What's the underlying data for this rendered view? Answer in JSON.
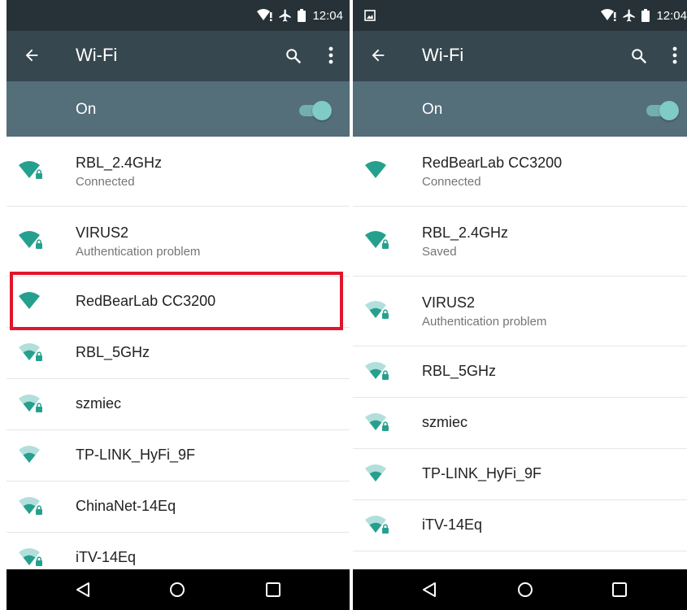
{
  "status_bar": {
    "time": "12:04",
    "icons": [
      "wifi-alert-icon",
      "airplane-icon",
      "battery-icon"
    ],
    "notification_icon": "image-icon"
  },
  "app_bar": {
    "title": "Wi-Fi",
    "back_icon": "arrow-left-icon",
    "search_icon": "search-icon",
    "more_icon": "more-vert-icon"
  },
  "wifi_switch": {
    "label": "On",
    "state": true
  },
  "nav_bar": {
    "icons": [
      "back-triangle-icon",
      "home-circle-icon",
      "recents-square-icon"
    ]
  },
  "colors": {
    "status_bar": "#263238",
    "app_bar": "#37474f",
    "switch_bar": "#546e7a",
    "accent": "#26a08e",
    "weak_signal": "#b2dfdb",
    "highlight": "#e1162b"
  },
  "left_screen": {
    "networks": [
      {
        "ssid": "RBL_2.4GHz",
        "status": "Connected",
        "signal": 4,
        "secured": true
      },
      {
        "ssid": "VIRUS2",
        "status": "Authentication problem",
        "signal": 4,
        "secured": true
      },
      {
        "ssid": "RedBearLab CC3200",
        "status": "",
        "signal": 4,
        "secured": false,
        "highlighted": true
      },
      {
        "ssid": "RBL_5GHz",
        "status": "",
        "signal": 2,
        "secured": true
      },
      {
        "ssid": "szmiec",
        "status": "",
        "signal": 2,
        "secured": true
      },
      {
        "ssid": "TP-LINK_HyFi_9F",
        "status": "",
        "signal": 2,
        "secured": false
      },
      {
        "ssid": "ChinaNet-14Eq",
        "status": "",
        "signal": 2,
        "secured": true
      },
      {
        "ssid": "iTV-14Eq",
        "status": "",
        "signal": 2,
        "secured": true
      }
    ]
  },
  "right_screen": {
    "networks": [
      {
        "ssid": "RedBearLab CC3200",
        "status": "Connected",
        "signal": 4,
        "secured": false
      },
      {
        "ssid": "RBL_2.4GHz",
        "status": "Saved",
        "signal": 4,
        "secured": true
      },
      {
        "ssid": "VIRUS2",
        "status": "Authentication problem",
        "signal": 2,
        "secured": true
      },
      {
        "ssid": "RBL_5GHz",
        "status": "",
        "signal": 2,
        "secured": true
      },
      {
        "ssid": "szmiec",
        "status": "",
        "signal": 2,
        "secured": true
      },
      {
        "ssid": "TP-LINK_HyFi_9F",
        "status": "",
        "signal": 2,
        "secured": false
      },
      {
        "ssid": "iTV-14Eq",
        "status": "",
        "signal": 2,
        "secured": true
      }
    ]
  }
}
